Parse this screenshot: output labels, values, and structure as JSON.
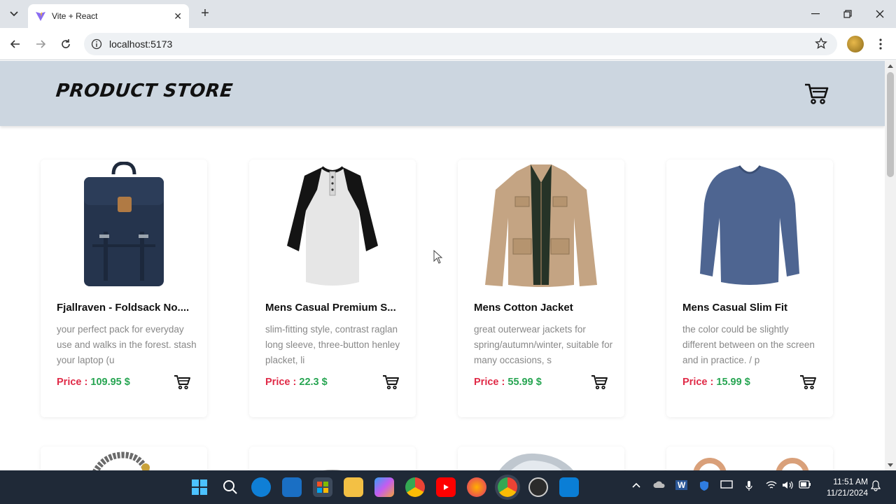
{
  "browser": {
    "tab_title": "Vite + React",
    "url": "localhost:5173"
  },
  "store": {
    "brand": "PRODUCT STORE",
    "products": [
      {
        "name": "Fjallraven - Foldsack No....",
        "description": "your perfect pack for everyday use and walks in the forest. stash your laptop (u",
        "price_label": "Price :",
        "price_value": "109.95 $"
      },
      {
        "name": "Mens Casual Premium S...",
        "description": "slim-fitting style, contrast raglan long sleeve, three-button henley placket, li",
        "price_label": "Price :",
        "price_value": "22.3 $"
      },
      {
        "name": "Mens Cotton Jacket",
        "description": "great outerwear jackets for spring/autumn/winter, suitable for many occasions, s",
        "price_label": "Price :",
        "price_value": "55.99 $"
      },
      {
        "name": "Mens Casual Slim Fit",
        "description": "the color could be slightly different between on the screen and in practice. / p",
        "price_label": "Price :",
        "price_value": "15.99 $"
      }
    ]
  },
  "taskbar": {
    "time": "11:51 AM",
    "date": "11/21/2024"
  },
  "colors": {
    "header_bg": "#ccd6e0",
    "price_label": "#e02a47",
    "price_value": "#27a552"
  }
}
